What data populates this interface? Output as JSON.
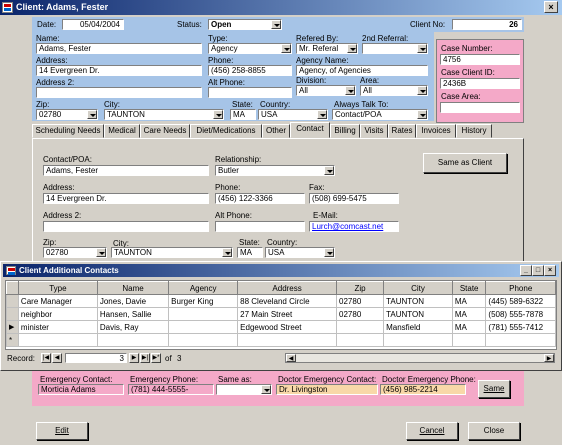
{
  "window": {
    "title": "Client: Adams, Fester"
  },
  "header": {
    "date_label": "Date:",
    "date_value": "05/04/2004",
    "status_label": "Status:",
    "status_value": "Open",
    "client_no_label": "Client No:",
    "client_no_value": "26"
  },
  "client": {
    "name_label": "Name:",
    "name_value": "Adams, Fester",
    "type_label": "Type:",
    "type_value": "Agency",
    "referred_by_label": "Refered By:",
    "referred_by_value": "Mr. Referal",
    "second_referral_label": "2nd Referral:",
    "second_referral_value": "",
    "address_label": "Address:",
    "address_value": "14 Evergreen Dr.",
    "phone_label": "Phone:",
    "phone_value": "(456) 258-8855",
    "agency_name_label": "Agency Name:",
    "agency_name_value": "Agency, of Agencies",
    "address2_label": "Address 2:",
    "address2_value": "",
    "alt_phone_label": "Alt Phone:",
    "alt_phone_value": "",
    "division_label": "Division:",
    "division_value": "All",
    "area_label": "Area:",
    "area_value": "All",
    "zip_label": "Zip:",
    "zip_value": "02780",
    "city_label": "City:",
    "city_value": "TAUNTON",
    "state_label": "State:",
    "state_value": "MA",
    "country_label": "Country:",
    "country_value": "USA",
    "always_talk_label": "Always Talk To:",
    "always_talk_value": "Contact/POA"
  },
  "case": {
    "number_label": "Case Number:",
    "number_value": "4756",
    "client_id_label": "Case Client ID:",
    "client_id_value": "2436B",
    "area_label": "Case Area:",
    "area_value": ""
  },
  "tabs": [
    {
      "label": "Scheduling Needs"
    },
    {
      "label": "Medical"
    },
    {
      "label": "Care Needs"
    },
    {
      "label": "Diet/Medications"
    },
    {
      "label": "Other"
    },
    {
      "label": "Contact"
    },
    {
      "label": "Billing"
    },
    {
      "label": "Visits"
    },
    {
      "label": "Rates"
    },
    {
      "label": "Invoices"
    },
    {
      "label": "History"
    }
  ],
  "contact": {
    "poa_label": "Contact/POA:",
    "poa_value": "Adams, Fester",
    "relationship_label": "Relationship:",
    "relationship_value": "Butler",
    "same_as_client_label": "Same as Client",
    "address_label": "Address:",
    "address_value": "14 Evergreen Dr.",
    "phone_label": "Phone:",
    "phone_value": "(456) 122-3366",
    "fax_label": "Fax:",
    "fax_value": "(508) 699-5475",
    "address2_label": "Address 2:",
    "address2_value": "",
    "alt_phone_label": "Alt Phone:",
    "alt_phone_value": "",
    "email_label": "E-Mail:",
    "email_value": "Lurch@comcast.net",
    "zip_label": "Zip:",
    "zip_value": "02780",
    "city_label": "City:",
    "city_value": "TAUNTON",
    "state_label": "State:",
    "state_value": "MA",
    "country_label": "Country:",
    "country_value": "USA"
  },
  "additional": {
    "title": "Client Additional Contacts",
    "columns": [
      "Type",
      "Name",
      "Agency",
      "Address",
      "Zip",
      "City",
      "State",
      "Phone"
    ],
    "rows": [
      [
        "Care Manager",
        "Jones, Davie",
        "Burger King",
        "88 Cleveland Circle",
        "02780",
        "TAUNTON",
        "MA",
        "(445) 589-6322"
      ],
      [
        "neighbor",
        "Hansen, Sallie",
        "",
        "27 Main Street",
        "02780",
        "TAUNTON",
        "MA",
        "(508) 555-7878"
      ],
      [
        "minister",
        "Davis, Ray",
        "",
        "Edgewood Street",
        "",
        "Mansfield",
        "MA",
        "(781) 555-7412"
      ]
    ],
    "record_label": "Record:",
    "record_value": "3",
    "of_label": "of",
    "total": "3"
  },
  "emergency": {
    "contact_label": "Emergency Contact:",
    "contact_value": "Morticia Adams",
    "phone_label": "Emergency Phone:",
    "phone_value": "(781) 444-5555-",
    "same_as_label": "Same as:",
    "same_as_value": "",
    "doctor_label": "Doctor Emergency Contact:",
    "doctor_value": "Dr. Livingston",
    "doctor_phone_label": "Doctor Emergency Phone:",
    "doctor_phone_value": "(456) 985-2214",
    "same_button": "Same"
  },
  "footer": {
    "edit": "Edit",
    "cancel": "Cancel",
    "close": "Close"
  }
}
